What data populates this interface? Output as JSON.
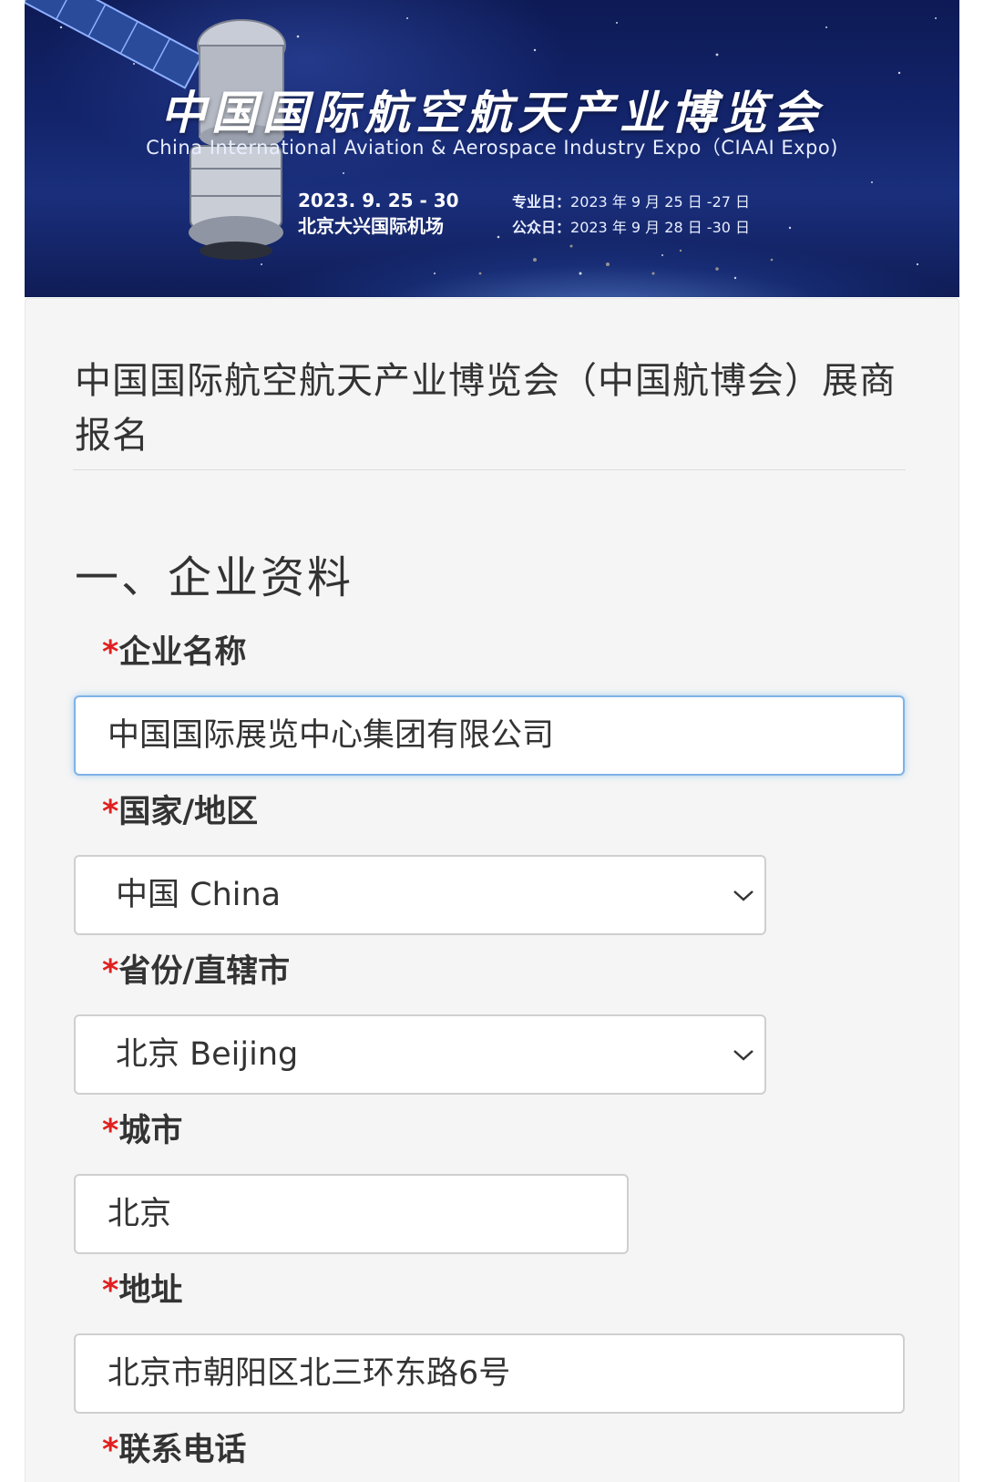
{
  "banner": {
    "title": "中国国际航空航天产业博览会",
    "subtitle": "China International Aviation & Aerospace Industry Expo（CIAAI Expo)",
    "date": "2023. 9. 25 - 30",
    "venue": "北京大兴国际机场",
    "professional_day_label": "专业日：",
    "professional_day_value": "2023 年 9 月 25 日 -27 日",
    "public_day_label": "公众日：",
    "public_day_value": "2023 年 9 月 28 日 -30 日"
  },
  "form": {
    "title": "中国国际航空航天产业博览会（中国航博会）展商报名",
    "section_title": "一、企业资料",
    "required_mark": "*",
    "fields": {
      "company_name": {
        "label": "企业名称",
        "value": "中国国际展览中心集团有限公司"
      },
      "country": {
        "label": "国家/地区",
        "value": "中国 China"
      },
      "province": {
        "label": "省份/直辖市",
        "value": "北京 Beijing"
      },
      "city": {
        "label": "城市",
        "value": "北京"
      },
      "address": {
        "label": "地址",
        "value": "北京市朝阳区北三环东路6号"
      },
      "phone": {
        "label": "联系电话"
      }
    }
  },
  "colors": {
    "required": "#e02020",
    "focus_border": "#7fb2e6",
    "card_bg": "#f5f5f5",
    "banner_bg": "#13246b"
  },
  "icons": {
    "dropdown": "chevron-down-icon",
    "banner_art": "satellite-illustration"
  }
}
